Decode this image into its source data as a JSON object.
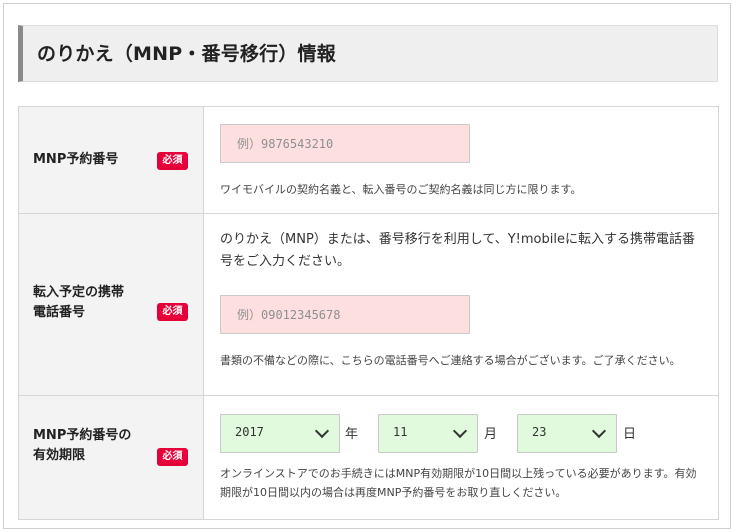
{
  "section": {
    "title": "のりかえ（MNP・番号移行）情報"
  },
  "rows": [
    {
      "label": "MNP予約番号",
      "required": "必須",
      "input_placeholder": "例）9876543210",
      "input_value": "",
      "note": "ワイモバイルの契約名義と、転入番号のご契約名義は同じ方に限ります。"
    },
    {
      "label_line1": "転入予定の携帯",
      "label_line2": "電話番号",
      "required": "必須",
      "intro": "のりかえ（MNP）または、番号移行を利用して、Y!mobileに転入する携帯電話番号をご入力ください。",
      "input_placeholder": "例）09012345678",
      "input_value": "",
      "note": "書類の不備などの際に、こちらの電話番号へご連絡する場合がございます。ご了承ください。"
    },
    {
      "label_line1": "MNP予約番号の",
      "label_line2": "有効期限",
      "required": "必須",
      "year": "2017",
      "year_unit": "年",
      "month": "11",
      "month_unit": "月",
      "day": "23",
      "day_unit": "日",
      "note": "オンラインストアでのお手続きにはMNP有効期限が10日間以上残っている必要があります。有効期限が10日間以内の場合は再度MNP予約番号をお取り直しください。"
    }
  ],
  "colors": {
    "required_badge": "#e60039",
    "phone_input_bg": "#fedfe0",
    "date_select_bg": "#e1fade",
    "header_bg": "#efefef"
  },
  "icons": [
    "chevron-down-icon"
  ]
}
